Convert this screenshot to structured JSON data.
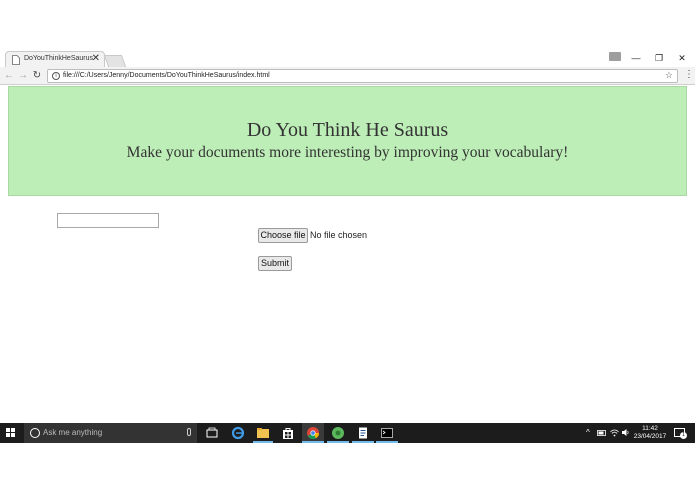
{
  "browser": {
    "tab_title": "DoYouThinkHeSaurus",
    "tab_close": "✕",
    "url": "file:///C:/Users/Jenny/Documents/DoYouThinkHeSaurus/index.html",
    "back_glyph": "←",
    "forward_glyph": "→",
    "reload_glyph": "↻",
    "info_glyph": "i",
    "star_glyph": "☆",
    "menu_glyph": "⋮",
    "minimize_glyph": "—",
    "restore_glyph": "❐",
    "close_glyph": "✕"
  },
  "page": {
    "title": "Do You Think He Saurus",
    "subtitle": "Make your documents more interesting by improving your vocabulary!",
    "banner_color": "#bdeeb7",
    "word_input_value": "",
    "choose_file_label": "Choose file",
    "file_status": "No file chosen",
    "submit_label": "Submit"
  },
  "taskbar": {
    "search_placeholder": "Ask me anything",
    "time": "11:42",
    "date": "23/04/2017",
    "notification_count": "1",
    "tray_chevron": "^",
    "icons": [
      "task-view-icon",
      "edge-icon",
      "file-explorer-icon",
      "store-icon",
      "chrome-icon",
      "green-app-icon",
      "document-icon",
      "command-prompt-icon"
    ]
  }
}
